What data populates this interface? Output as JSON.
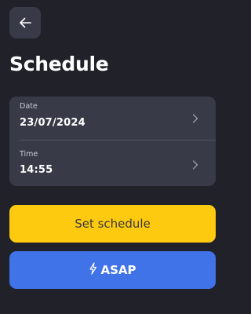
{
  "header": {
    "back_icon": "arrow-left-icon",
    "title": "Schedule"
  },
  "schedule": {
    "date": {
      "label": "Date",
      "value": "23/07/2024",
      "icon": "chevron-right-icon"
    },
    "time": {
      "label": "Time",
      "value": "14:55",
      "icon": "chevron-right-icon"
    }
  },
  "actions": {
    "set_schedule_label": "Set schedule",
    "asap_label": "ASAP",
    "asap_icon": "lightning-bolt-icon"
  },
  "colors": {
    "background": "#202129",
    "card": "#383b47",
    "primary_yellow": "#fdca0f",
    "accent_blue": "#4072e8"
  }
}
